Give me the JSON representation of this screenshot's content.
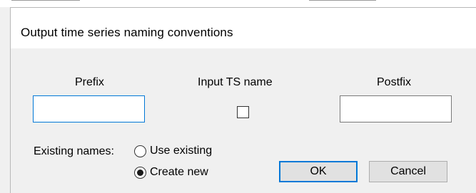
{
  "dialog": {
    "title": "Output time series naming conventions"
  },
  "fields": {
    "prefix_label": "Prefix",
    "prefix_value": "",
    "input_ts_label": "Input TS name",
    "input_ts_checked": false,
    "postfix_label": "Postfix",
    "postfix_value": ""
  },
  "existing_names": {
    "label": "Existing names:",
    "options": [
      {
        "label": "Use existing",
        "selected": false
      },
      {
        "label": "Create new",
        "selected": true
      }
    ]
  },
  "buttons": {
    "ok_label": "OK",
    "cancel_label": "Cancel"
  },
  "colors": {
    "focus_accent": "#0078d7",
    "window_bg": "#f0f0f0",
    "button_bg": "#e1e1e1"
  }
}
